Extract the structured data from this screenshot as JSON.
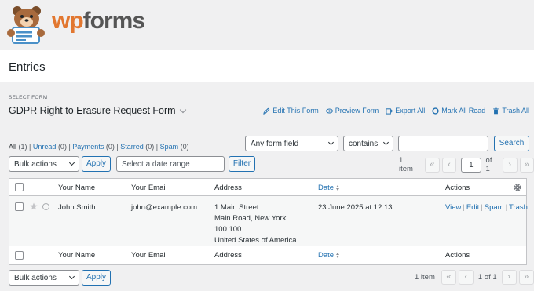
{
  "brand": {
    "wp": "wp",
    "forms": "forms",
    "mascot": "bear-mascot"
  },
  "page": {
    "title": "Entries"
  },
  "form_select": {
    "label": "SELECT FORM",
    "selected": "GDPR Right to Erasure Request Form"
  },
  "top_actions": [
    {
      "label": "Edit This Form",
      "icon": "pencil-icon"
    },
    {
      "label": "Preview Form",
      "icon": "eye-icon"
    },
    {
      "label": "Export All",
      "icon": "export-icon"
    },
    {
      "label": "Mark All Read",
      "icon": "circle-icon"
    },
    {
      "label": "Trash All",
      "icon": "trash-icon"
    }
  ],
  "filters": {
    "all": "All",
    "all_count": "(1)",
    "unread": "Unread",
    "unread_count": "(0)",
    "payments": "Payments",
    "payments_count": "(0)",
    "starred": "Starred",
    "starred_count": "(0)",
    "spam": "Spam",
    "spam_count": "(0)"
  },
  "search": {
    "field": "Any form field",
    "operator": "contains",
    "value": "",
    "button": "Search"
  },
  "bulk": {
    "selected": "Bulk actions",
    "apply": "Apply",
    "date_placeholder": "Select a date range",
    "filter": "Filter"
  },
  "pagination": {
    "items": "1 item",
    "current": "1",
    "of": "of 1",
    "footer_page": "1 of 1"
  },
  "table": {
    "columns": [
      "Your Name",
      "Your Email",
      "Address",
      "Date",
      "Actions"
    ],
    "rows": [
      {
        "name": "John Smith",
        "email": "john@example.com",
        "address": [
          "1 Main Street",
          "Main Road, New York",
          "100 100",
          "United States of America"
        ],
        "date": "23 June 2025 at 12:13",
        "actions": [
          "View",
          "Edit",
          "Spam",
          "Trash"
        ]
      }
    ]
  },
  "colors": {
    "accent": "#2271b1",
    "brand_orange": "#e27730",
    "background": "#f0f0f1"
  }
}
